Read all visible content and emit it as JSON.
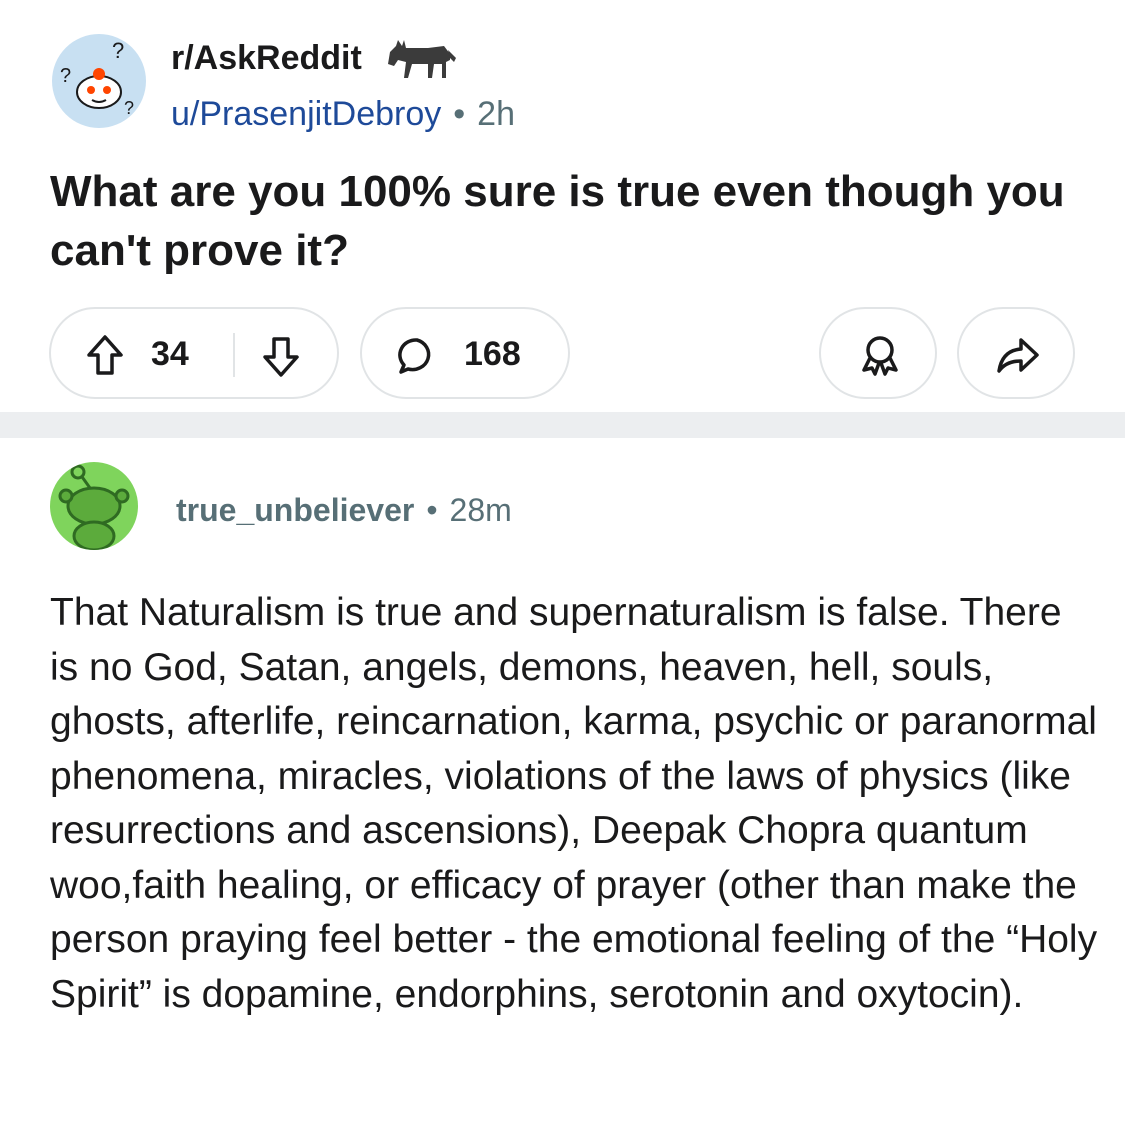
{
  "post": {
    "subreddit": "r/AskReddit",
    "author": "u/PrasenjitDebroy",
    "separator": "•",
    "age": "2h",
    "title": "What are you 100% sure is true even though you can't prove it?",
    "upvotes": "34",
    "comments": "168",
    "icons": [
      "subreddit-avatar-icon",
      "donkey-flair-icon",
      "upvote-icon",
      "downvote-icon",
      "comment-icon",
      "award-icon",
      "share-icon"
    ]
  },
  "comment": {
    "author": "true_unbeliever",
    "separator": "•",
    "age": "28m",
    "body": "That Naturalism is true and supernaturalism is false.  There is no God, Satan, angels, demons, heaven, hell, souls, ghosts, afterlife, reincarnation, karma, psychic or paranormal phenomena, miracles, violations of the laws of physics (like resurrections and ascensions), Deepak Chopra quantum woo,faith healing, or efficacy of prayer (other than make the person praying feel better - the emotional feeling of the “Holy Spirit” is dopamine, endorphins, serotonin and oxytocin)."
  },
  "colors": {
    "author_link": "#1e4a99",
    "meta_gray": "#576f76",
    "pill_border": "#e1e4e6",
    "separator_band": "#eceef0",
    "commenter_avatar": "#7fd45c"
  }
}
